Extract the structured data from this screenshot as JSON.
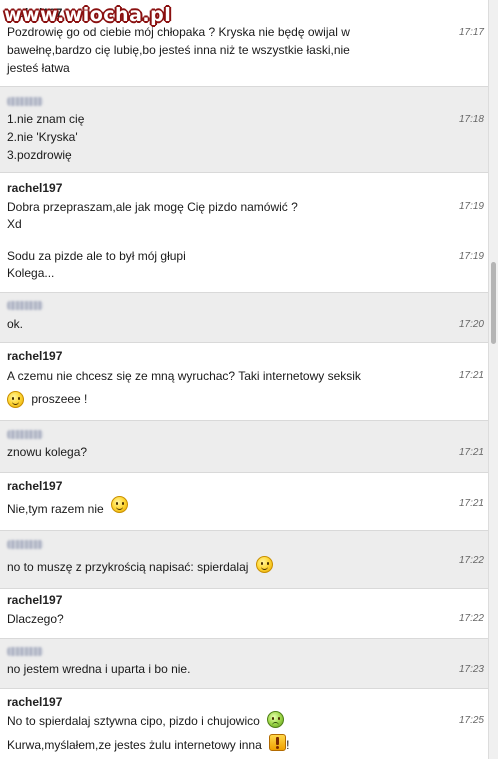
{
  "watermark": "www.wiocha.pl",
  "messages": [
    {
      "sender": "rachel197",
      "lines": [
        "Pozdrowię go od ciebie mój chłopaka ? Kryska nie będę owijal w",
        "bawełnę,bardzo cię lubię,bo jesteś inna niż te wszystkie łaski,nie",
        "jesteś łatwa"
      ],
      "time": "17:17"
    },
    {
      "sender": "",
      "lines": [
        "1.nie znam cię",
        "2.nie 'Kryska'",
        "3.pozdrowię"
      ],
      "time": "17:18"
    },
    {
      "sender": "rachel197",
      "lines": [
        "Dobra przepraszam,ale jak mogę Cię pizdo namówić ?",
        "Xd"
      ],
      "time": "17:19"
    },
    {
      "sender": "",
      "lines": [
        "Sodu za pizde ale to był mój głupi",
        "Kolega..."
      ],
      "time": "17:19"
    },
    {
      "sender": "",
      "lines": [
        "ok."
      ],
      "time": "17:20"
    },
    {
      "sender": "rachel197",
      "lines": [
        "A czemu nie chcesz się ze mną wyruchac? Taki internetowy seksik",
        "proszeee !"
      ],
      "time": "17:21"
    },
    {
      "sender": "",
      "lines": [
        "znowu kolega?"
      ],
      "time": "17:21"
    },
    {
      "sender": "rachel197",
      "lines": [
        "Nie,tym razem nie"
      ],
      "time": "17:21"
    },
    {
      "sender": "",
      "lines": [
        "no to muszę z przykrością napisać: spierdalaj"
      ],
      "time": "17:22"
    },
    {
      "sender": "rachel197",
      "lines": [
        "Dlaczego?"
      ],
      "time": "17:22"
    },
    {
      "sender": "",
      "lines": [
        "no jestem wredna i uparta i bo nie."
      ],
      "time": "17:23"
    },
    {
      "sender": "rachel197",
      "lines": [
        "No to spierdalaj sztywna cipo, pizdo i chujowico",
        "Kurwa,myślałem,ze jestes żulu internetowy inna",
        "!"
      ],
      "time": "17:25"
    }
  ],
  "icons": {
    "smile": "smiley-icon",
    "sick": "sick-emoticon-icon",
    "exclaim": "exclamation-emoticon-icon"
  }
}
